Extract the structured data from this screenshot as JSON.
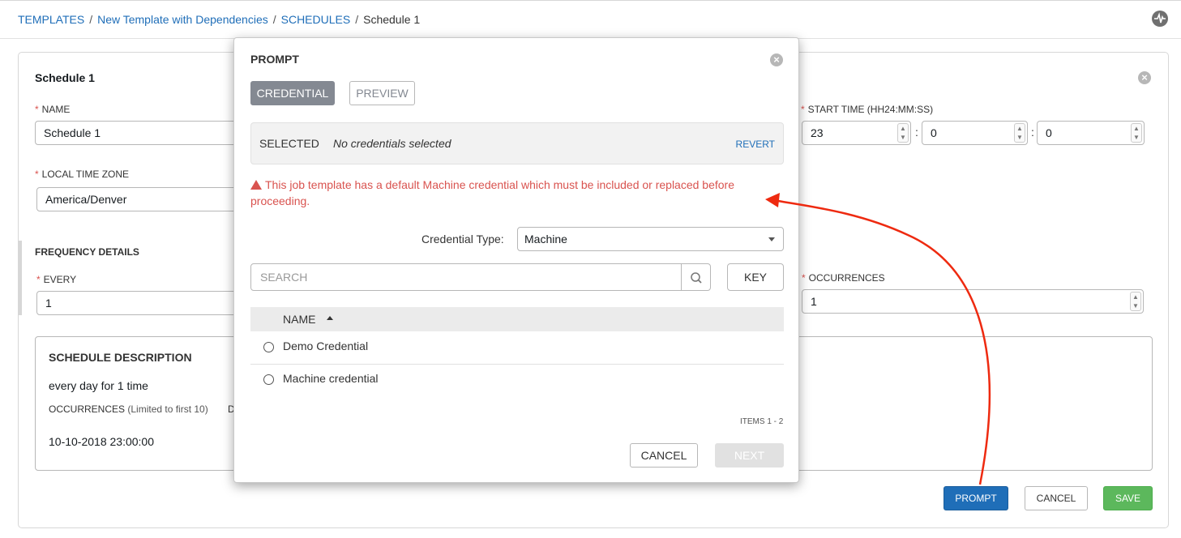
{
  "breadcrumb": {
    "items": [
      "TEMPLATES",
      "New Template with Dependencies",
      "SCHEDULES"
    ],
    "separator": "/",
    "current": "Schedule 1"
  },
  "schedule": {
    "title": "Schedule 1",
    "name_label": "NAME",
    "name_value": "Schedule 1",
    "timezone_label": "LOCAL TIME ZONE",
    "timezone_value": "America/Denver",
    "start_time_label": "START TIME (HH24:MM:SS)",
    "start_hour": "23",
    "start_minute": "0",
    "start_second": "0",
    "time_separator": ":",
    "frequency_heading": "FREQUENCY DETAILS",
    "every_label": "EVERY",
    "every_value": "1",
    "occurrences_label": "OCCURRENCES",
    "occurrences_value": "1",
    "required_mark": "*"
  },
  "description": {
    "heading": "SCHEDULE DESCRIPTION",
    "text": "every day for 1 time",
    "occurrences_label": "OCCURRENCES",
    "occurrences_note": "(Limited to first 10)",
    "date_label_partial": "D",
    "first_occurrence": "10-10-2018 23:00:00"
  },
  "footer_buttons": {
    "prompt": "PROMPT",
    "cancel": "CANCEL",
    "save": "SAVE"
  },
  "modal": {
    "title": "PROMPT",
    "tabs": [
      "CREDENTIAL",
      "PREVIEW"
    ],
    "selected_label": "SELECTED",
    "selected_value": "No credentials selected",
    "revert": "REVERT",
    "warning": "This job template has a default Machine credential which must be included or replaced before proceeding.",
    "credential_type_label": "Credential Type:",
    "credential_type_value": "Machine",
    "search_placeholder": "SEARCH",
    "key_button": "KEY",
    "column_name": "NAME",
    "rows": [
      "Demo Credential",
      "Machine credential"
    ],
    "items_label": "ITEMS  1 - 2",
    "cancel": "CANCEL",
    "next": "NEXT"
  },
  "colors": {
    "link": "#1f6eb8",
    "primary": "#1f6eb8",
    "success": "#5cb85c",
    "danger": "#d9534f",
    "annotation_arrow": "#ee2a10"
  },
  "icons": [
    "activity-stream-icon",
    "close-icon",
    "warning-icon",
    "search-icon",
    "sort-up-icon",
    "dropdown-caret-icon"
  ]
}
